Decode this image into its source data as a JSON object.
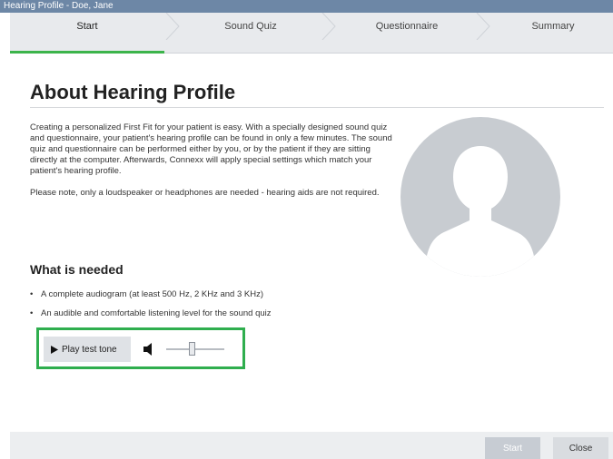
{
  "window": {
    "title": "Hearing Profile - Doe, Jane"
  },
  "tabs": [
    {
      "label": "Start",
      "active": true
    },
    {
      "label": "Sound Quiz",
      "active": false
    },
    {
      "label": "Questionnaire",
      "active": false
    },
    {
      "label": "Summary",
      "active": false
    }
  ],
  "main": {
    "title": "About Hearing Profile",
    "intro": [
      "Creating a personalized First Fit for your patient is easy. With a specially designed sound quiz and questionnaire, your patient's hearing profile can be found in only a few minutes. The sound quiz and questionnaire can be performed either by you, or by the patient if they are sitting directly at the computer. Afterwards, Connexx will apply special settings which match your patient's hearing profile.",
      "Please note, only a loudspeaker or headphones are needed - hearing aids are not required."
    ],
    "needed_heading": "What is needed",
    "needed_items": [
      "A complete audiogram (at least 500 Hz, 2 KHz and 3 KHz)",
      "An audible and comfortable listening level for the sound quiz"
    ],
    "test_tone": {
      "play_label": "Play test tone",
      "volume_level": 0.45
    },
    "avatar_icon": "user-silhouette-icon"
  },
  "footer": {
    "start_label": "Start",
    "close_label": "Close"
  },
  "colors": {
    "titlebar": "#6d87a6",
    "active_tab_underline": "#3cb44b",
    "highlight_border": "#2fae4e",
    "avatar": "#c8ccd1"
  }
}
